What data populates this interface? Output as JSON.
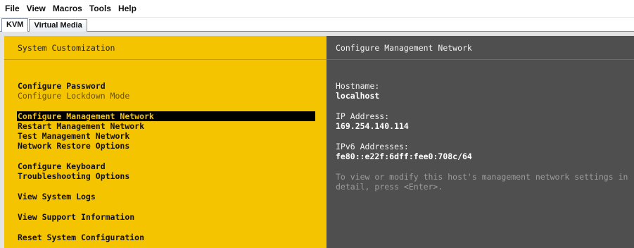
{
  "menubar": {
    "items": [
      "File",
      "View",
      "Macros",
      "Tools",
      "Help"
    ]
  },
  "tabs": [
    {
      "label": "KVM",
      "active": true
    },
    {
      "label": "Virtual Media",
      "active": false
    }
  ],
  "left_pane": {
    "title": "System Customization",
    "items": [
      {
        "label": "Configure Password",
        "state": "normal"
      },
      {
        "label": "Configure Lockdown Mode",
        "state": "disabled"
      },
      {
        "label": "Configure Management Network",
        "state": "selected"
      },
      {
        "label": "Restart Management Network",
        "state": "normal"
      },
      {
        "label": "Test Management Network",
        "state": "normal"
      },
      {
        "label": "Network Restore Options",
        "state": "normal"
      },
      {
        "label": "Configure Keyboard",
        "state": "normal"
      },
      {
        "label": "Troubleshooting Options",
        "state": "normal"
      },
      {
        "label": "View System Logs",
        "state": "normal"
      },
      {
        "label": "View Support Information",
        "state": "normal"
      },
      {
        "label": "Reset System Configuration",
        "state": "normal"
      }
    ]
  },
  "right_pane": {
    "title": "Configure Management Network",
    "hostname_label": "Hostname:",
    "hostname_value": "localhost",
    "ip_label": "IP Address:",
    "ip_value": "169.254.140.114",
    "ipv6_label": "IPv6 Addresses:",
    "ipv6_value": "fe80::e22f:6dff:fee0:708c/64",
    "hint_line1": "To view or modify this host's management network settings in",
    "hint_line2": "detail, press <Enter>."
  },
  "colors": {
    "left_pane_bg": "#f5c400",
    "right_pane_bg": "#4f4f4f",
    "selection_bg": "#000000"
  }
}
